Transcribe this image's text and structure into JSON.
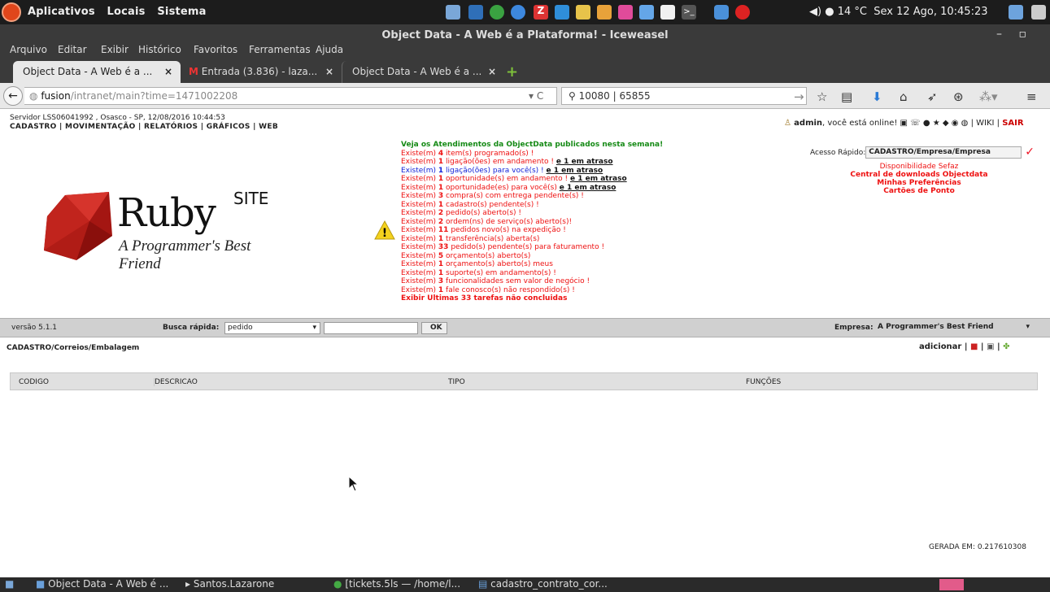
{
  "desktop": {
    "menu": [
      "Aplicativos",
      "Locais",
      "Sistema"
    ],
    "weather": "14 °C",
    "datetime": "Sex 12 Ago, 10:45:23"
  },
  "window": {
    "title": "Object Data - A Web é a Plataforma! - Iceweasel"
  },
  "menubar": [
    "Arquivo",
    "Editar",
    "Exibir",
    "Histórico",
    "Favoritos",
    "Ferramentas",
    "Ajuda"
  ],
  "tabs": [
    {
      "label": "Object Data - A Web é a ..."
    },
    {
      "label": "Entrada (3.836) - laza..."
    },
    {
      "label": "Object Data - A Web é a ..."
    }
  ],
  "address": {
    "host": "fusion",
    "path": "/intranet/main?time=1471002208"
  },
  "search": {
    "value": "10080 | 65855"
  },
  "page": {
    "server": "Servidor LSS06041992 , Osasco - SP, 12/08/2016 10:44:53",
    "topnav": "CADASTRO | MOVIMENTAÇÃO | RELATÓRIOS | GRÁFICOS | WEB",
    "user": {
      "name": "admin",
      "status": ", você está online!",
      "wiki": "WIKI",
      "exit": "SAIR"
    },
    "logo": {
      "word": "Ruby",
      "tagline": "A Programmer's Best Friend",
      "site": "SITE"
    },
    "notices": {
      "headline": "Veja os Atendimentos da ObjectData publicados nesta semana!",
      "footer": "Exibir Ultimas 33 tarefas não concluidas"
    },
    "quick": {
      "label": "Acesso Rápido:",
      "value": "CADASTRO/Empresa/Empresa",
      "links": [
        "Disponibilidade Sefaz",
        "Central de downloads Objectdata",
        "Minhas Preferências",
        "Cartões de Ponto"
      ]
    },
    "bar": {
      "version": "versão 5.1.1",
      "quick_label": "Busca rápida:",
      "quick_value": "pedido",
      "ok": "OK",
      "company_label": "Empresa:",
      "company_value": "A Programmer's Best Friend"
    },
    "crumb": "CADASTRO/Correios/Embalagem",
    "add": "adicionar",
    "columns": [
      "CODIGO",
      "DESCRICAO",
      "TIPO",
      "FUNÇÕES"
    ],
    "generated": "GERADA EM: 0.217610308"
  },
  "taskbar": [
    "Object Data - A Web é ...",
    "Santos.Lazarone",
    "[tickets.5ls — /home/l...",
    "cadastro_contrato_cor..."
  ]
}
